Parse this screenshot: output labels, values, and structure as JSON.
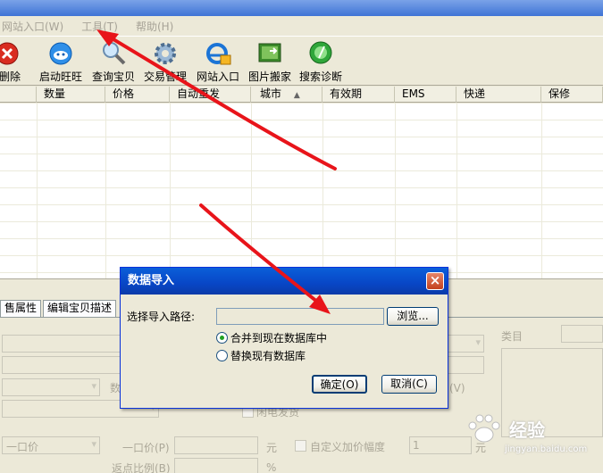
{
  "menu": [
    {
      "label": "网站入口(W)"
    },
    {
      "label": "工具(T)"
    },
    {
      "label": "帮助(H)"
    }
  ],
  "toolbar": [
    {
      "label": "删除",
      "icon": "delete-icon"
    },
    {
      "label": "启动旺旺",
      "icon": "wangwang-icon"
    },
    {
      "label": "查询宝贝",
      "icon": "magnifier-icon"
    },
    {
      "label": "交易管理",
      "icon": "gear-icon"
    },
    {
      "label": "网站入口",
      "icon": "ie-icon"
    },
    {
      "label": "图片搬家",
      "icon": "picture-move-icon"
    },
    {
      "label": "搜索诊断",
      "icon": "diagnose-icon"
    }
  ],
  "table": {
    "columns": [
      "数量",
      "价格",
      "自动重发",
      "城市",
      "有效期",
      "EMS",
      "快递",
      "保修"
    ],
    "sort_indicator": "▲"
  },
  "tabs": [
    "售属性",
    "编辑宝贝描述"
  ],
  "lower_form": {
    "label_partial": "数",
    "checkbox_text": "闲电发货",
    "price_mode": "一口价",
    "price_label": "一口价(P)",
    "yuan": "元",
    "custom_price_label": "自定义加价幅度",
    "custom_price_value": "1",
    "yuan2": "元",
    "rebate_label": "返点比例(B)",
    "percent": "%",
    "category_label": "类目",
    "v_label": "(V)"
  },
  "dialog": {
    "title": "数据导入",
    "close": "×",
    "path_label": "选择导入路径:",
    "path_value": "",
    "browse_button": "浏览...",
    "option_merge": "合并到现在数据库中",
    "option_replace": "替换现有数据库",
    "selected_option": "merge",
    "ok_button": "确定(O)",
    "cancel_button": "取消(C)"
  },
  "watermark": {
    "brand": "经验",
    "url": "jingyan.baidu.com"
  },
  "colors": {
    "arrow": "#e8141a",
    "dialog_title": "#0a4fd0",
    "window_bg": "#ece9d8"
  }
}
